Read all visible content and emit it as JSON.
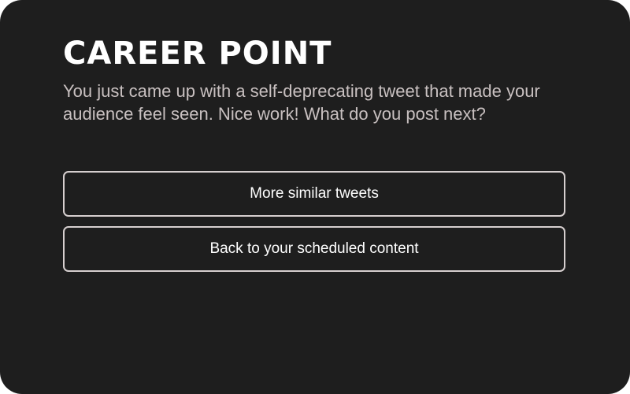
{
  "card": {
    "title": "CAREER POINT",
    "prompt": "You just came up with a self-deprecating tweet that made your audience feel seen. Nice work! What do you post next?",
    "choices": [
      {
        "label": "More similar tweets"
      },
      {
        "label": "Back to your scheduled content"
      }
    ]
  },
  "colors": {
    "card_background": "#1e1e1e",
    "title": "#ffffff",
    "prompt_text": "#c8c0c0",
    "button_border": "#d6cfcf",
    "button_text": "#ffffff"
  }
}
